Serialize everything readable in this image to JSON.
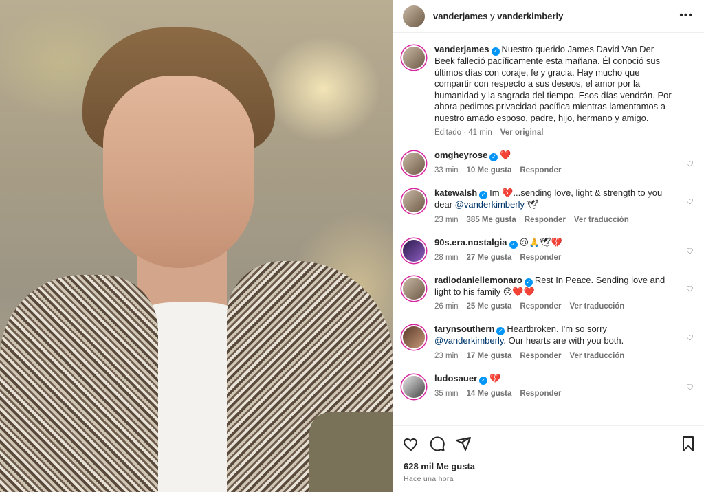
{
  "header": {
    "user1": "vanderjames",
    "joiner": "y",
    "user2": "vanderkimberly",
    "more_icon": "more-horizontal-icon"
  },
  "caption": {
    "user": "vanderjames",
    "text": "Nuestro querido James David Van Der Beek falleció pacíficamente esta mañana. Él conoció sus últimos días con coraje, fe y gracia. Hay mucho que compartir con respecto a sus deseos, el amor por la humanidad y la sagrada del tiempo. Esos días vendrán. Por ahora pedimos privacidad pacífica mientras lamentamos a nuestro amado esposo, padre, hijo, hermano y amigo.",
    "edited": "Editado",
    "time": "41 min",
    "see_original": "Ver original"
  },
  "comments": [
    {
      "user": "omgheyrose",
      "text_before": "❤️",
      "mention": "",
      "text_after": "",
      "time": "33 min",
      "likes": "10 Me gusta",
      "reply": "Responder",
      "translate": ""
    },
    {
      "user": "katewalsh",
      "text_before": "Im 💔...sending love, light & strength to you dear ",
      "mention": "@vanderkimberly",
      "text_after": " 🕊",
      "time": "23 min",
      "likes": "385 Me gusta",
      "reply": "Responder",
      "translate": "Ver traducción"
    },
    {
      "user": "90s.era.nostalgia",
      "text_before": "😢🙏🕊💔",
      "mention": "",
      "text_after": "",
      "time": "28 min",
      "likes": "27 Me gusta",
      "reply": "Responder",
      "translate": ""
    },
    {
      "user": "radiodaniellemonaro",
      "text_before": "Rest In Peace. Sending love and light to his family 😢❤️❤️",
      "mention": "",
      "text_after": "",
      "time": "26 min",
      "likes": "25 Me gusta",
      "reply": "Responder",
      "translate": "Ver traducción"
    },
    {
      "user": "tarynsouthern",
      "text_before": "Heartbroken. I'm so sorry ",
      "mention": "@vanderkimberly",
      "text_after": ". Our hearts are with you both.",
      "time": "23 min",
      "likes": "17 Me gusta",
      "reply": "Responder",
      "translate": "Ver traducción"
    },
    {
      "user": "ludosauer",
      "text_before": "💔",
      "mention": "",
      "text_after": "",
      "time": "35 min",
      "likes": "14 Me gusta",
      "reply": "Responder",
      "translate": ""
    }
  ],
  "footer": {
    "likes": "628 mil Me gusta",
    "time": "Hace una hora",
    "icons": [
      "heart-icon",
      "comment-icon",
      "share-icon",
      "bookmark-icon"
    ]
  },
  "colors": {
    "verified": "#0095f6",
    "mention": "#00376b",
    "muted": "#737373",
    "text": "#262626",
    "border": "#efefef"
  }
}
